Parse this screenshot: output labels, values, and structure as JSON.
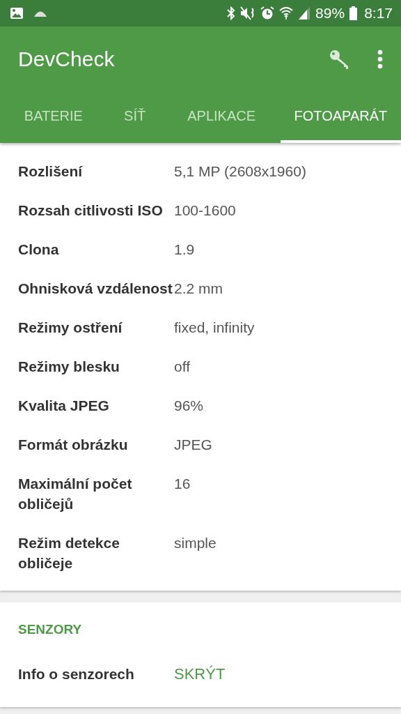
{
  "status_bar": {
    "battery": "89%",
    "time": "8:17"
  },
  "app_bar": {
    "title": "DevCheck"
  },
  "tabs": [
    {
      "label": "BATERIE",
      "selected": false
    },
    {
      "label": "SÍŤ",
      "selected": false
    },
    {
      "label": "APLIKACE",
      "selected": false
    },
    {
      "label": "FOTOAPARÁT",
      "selected": true
    }
  ],
  "camera_info": [
    {
      "label": "Rozlišení",
      "value": "5,1 MP (2608x1960)"
    },
    {
      "label": "Rozsah citlivosti ISO",
      "value": "100-1600"
    },
    {
      "label": "Clona",
      "value": "1.9"
    },
    {
      "label": "Ohnisková vzdálenost",
      "value": "2.2 mm"
    },
    {
      "label": "Režimy ostření",
      "value": "fixed, infinity"
    },
    {
      "label": "Režimy blesku",
      "value": "off"
    },
    {
      "label": "Kvalita JPEG",
      "value": "96%"
    },
    {
      "label": "Formát obrázku",
      "value": "JPEG"
    },
    {
      "label": "Maximální počet obličejů",
      "value": "16"
    },
    {
      "label": "Režim detekce obličeje",
      "value": "simple"
    }
  ],
  "sensors": {
    "heading": "SENZORY",
    "rows": [
      {
        "label": "Info o senzorech",
        "value": "SKRÝT",
        "kind": "action"
      }
    ]
  }
}
